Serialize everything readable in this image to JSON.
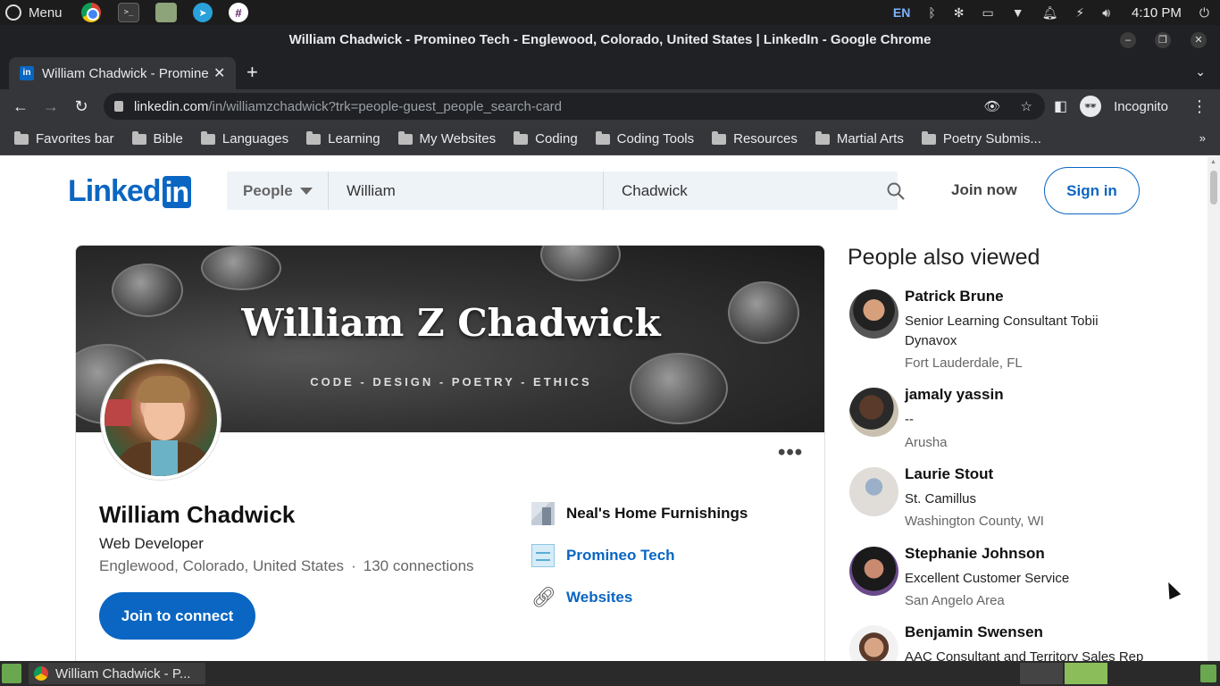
{
  "os": {
    "menu_label": "Menu",
    "launchers": [
      "chrome-icon",
      "terminal-icon",
      "files-icon",
      "telegram-icon",
      "slack-icon"
    ],
    "tray": {
      "lang": "EN",
      "clock": "4:10 PM"
    }
  },
  "browser": {
    "window_title": "William Chadwick - Promineo Tech - Englewood, Colorado, United States | LinkedIn - Google Chrome",
    "tab_title": "William Chadwick - Promineo Tech - Englewood, Colorado, United States | LinkedIn",
    "url_host": "linkedin.com",
    "url_path": "/in/williamzchadwick?trk=people-guest_people_search-card",
    "profile_label": "Incognito",
    "bookmarks": [
      "Favorites bar",
      "Bible",
      "Languages",
      "Learning",
      "My Websites",
      "Coding",
      "Coding Tools",
      "Resources",
      "Martial Arts",
      "Poetry Submis..."
    ]
  },
  "linkedin": {
    "logo_main": "Linked",
    "logo_box": "in",
    "search": {
      "type": "People",
      "first": "William",
      "last": "Chadwick"
    },
    "join_now": "Join now",
    "sign_in": "Sign in"
  },
  "profile": {
    "banner_title": "William Z Chadwick",
    "banner_subtitle": "CODE - DESIGN - POETRY - ETHICS",
    "name": "William Chadwick",
    "headline": "Web Developer",
    "location": "Englewood, Colorado, United States",
    "connections": "130 connections",
    "join_button": "Join to connect",
    "experience": "Neal's Home Furnishings",
    "education": "Promineo Tech",
    "websites": "Websites"
  },
  "people_also_viewed": {
    "title": "People also viewed",
    "people": [
      {
        "name": "Patrick Brune",
        "headline": "Senior Learning Consultant Tobii Dynavox",
        "location": "Fort Lauderdale, FL"
      },
      {
        "name": "jamaly yassin",
        "headline": "--",
        "location": "Arusha"
      },
      {
        "name": "Laurie Stout",
        "headline": "St. Camillus",
        "location": "Washington County, WI"
      },
      {
        "name": "Stephanie Johnson",
        "headline": "Excellent Customer Service",
        "location": "San Angelo Area"
      },
      {
        "name": "Benjamin Swensen",
        "headline": "AAC Consultant and Territory Sales Rep",
        "location": ""
      }
    ]
  },
  "taskbar": {
    "window_label": "William Chadwick - P..."
  },
  "colors": {
    "linkedin_blue": "#0a66c2",
    "chrome_dark": "#202124",
    "chrome_toolbar": "#35363a"
  }
}
